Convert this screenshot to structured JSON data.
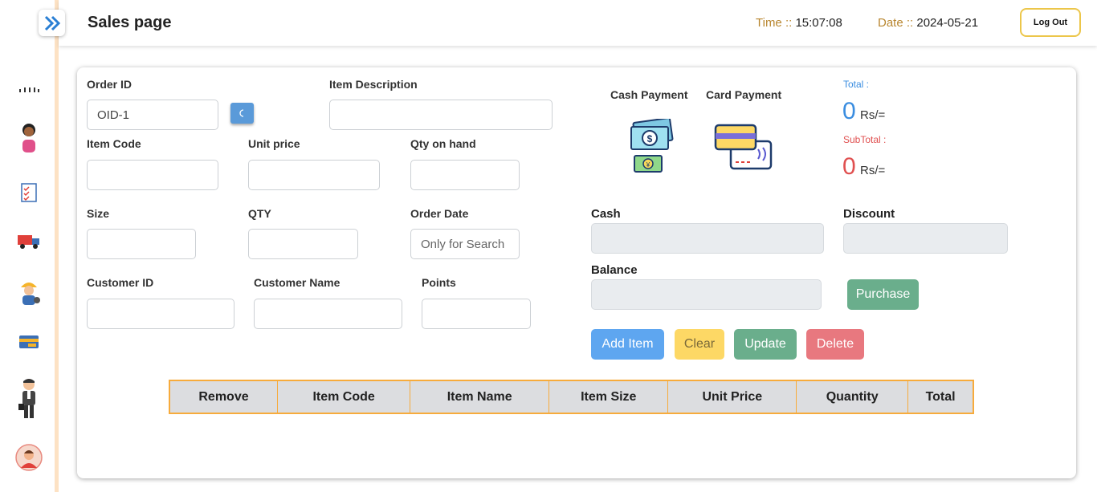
{
  "header": {
    "title": "Sales page",
    "time_label": "Time :: ",
    "time_value": "15:07:08",
    "date_label": "Date :: ",
    "date_value": "2024-05-21",
    "logout_label": "Log Out"
  },
  "sidebar": {
    "toggle_icon": "double-chevron-right-icon",
    "items": [
      {
        "name": "dashboard",
        "icon": "dots-icon"
      },
      {
        "name": "customer",
        "icon": "person-icon"
      },
      {
        "name": "orders",
        "icon": "checklist-icon"
      },
      {
        "name": "delivery",
        "icon": "truck-icon"
      },
      {
        "name": "employee",
        "icon": "worker-icon"
      },
      {
        "name": "payment",
        "icon": "card-icon"
      },
      {
        "name": "supplier",
        "icon": "businessman-icon"
      },
      {
        "name": "profile",
        "icon": "avatar-icon"
      }
    ]
  },
  "form": {
    "order_id_label": "Order ID",
    "order_id_value": "OID-1",
    "item_description_label": "Item Description",
    "item_description_value": "",
    "item_code_label": "Item Code",
    "unit_price_label": "Unit price",
    "qty_on_hand_label": "Qty on hand",
    "size_label": "Size",
    "qty_label": "QTY",
    "order_date_label": "Order Date",
    "order_date_placeholder": "Only for Search",
    "customer_id_label": "Customer ID",
    "customer_name_label": "Customer Name",
    "points_label": "Points"
  },
  "payment": {
    "cash_payment_label": "Cash Payment",
    "card_payment_label": "Card Payment",
    "total_label": "Total :",
    "total_value": "0",
    "total_unit": "Rs/=",
    "subtotal_label": "SubTotal :",
    "subtotal_value": "0",
    "subtotal_unit": "Rs/=",
    "cash_label": "Cash",
    "discount_label": "Discount",
    "balance_label": "Balance",
    "purchase_label": "Purchase"
  },
  "actions": {
    "add_item": "Add Item",
    "clear": "Clear",
    "update": "Update",
    "delete": "Delete"
  },
  "table": {
    "columns": [
      "Remove",
      "Item Code",
      "Item Name",
      "Item Size",
      "Unit Price",
      "Quantity",
      "Total"
    ]
  },
  "colors": {
    "accent_gold": "#b8862f",
    "total_blue": "#3a8de0",
    "subtotal_red": "#e05050",
    "add_btn": "#5ea6f0",
    "clear_btn": "#fdd865",
    "update_btn": "#6aae8c",
    "delete_btn": "#e8787f",
    "purchase_btn": "#6aae8c",
    "table_border": "#f7ab3c"
  }
}
